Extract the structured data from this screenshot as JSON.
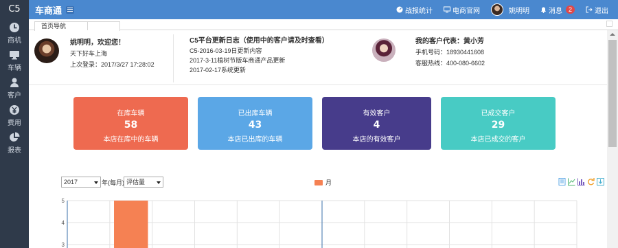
{
  "app": {
    "logo": "C5",
    "title": "车商通"
  },
  "sidebar": {
    "items": [
      {
        "label": "商机",
        "icon": "clock-icon"
      },
      {
        "label": "车辆",
        "icon": "monitor-icon"
      },
      {
        "label": "客户",
        "icon": "user-icon"
      },
      {
        "label": "费用",
        "icon": "yen-icon"
      },
      {
        "label": "报表",
        "icon": "pie-chart-icon"
      }
    ]
  },
  "topbar": {
    "stats": "战报统计",
    "site": "电商官网",
    "user": "姚明明",
    "messages": "消息",
    "message_count": "2",
    "logout": "退出"
  },
  "tabs": [
    {
      "label": "首页导航"
    }
  ],
  "info": {
    "welcome": "姚明明，欢迎您！",
    "slogan": "天下好车上海",
    "last_login": "上次登录：2017/3/27 17:28:02",
    "log_title": "C5平台更新日志（使用中的客户请及时查看）",
    "log_entries": [
      "C5-2016-03-19日更新内容",
      "2017-3-11植树节版车商通产品更新",
      "2017-02-17系统更新"
    ],
    "rep_title": "我的客户代表：黄小芳",
    "rep_phone": "手机号码：18930441608",
    "rep_hotline": "客服热线：400-080-6602"
  },
  "cards": [
    {
      "title": "在库车辆",
      "value": "58",
      "desc": "本店在库中的车辆",
      "color": "#ee6a50"
    },
    {
      "title": "已出库车辆",
      "value": "43",
      "desc": "本店已出库的车辆",
      "color": "#5ba7e6"
    },
    {
      "title": "有效客户",
      "value": "4",
      "desc": "本店的有效客户",
      "color": "#473c8b"
    },
    {
      "title": "已成交客户",
      "value": "29",
      "desc": "本店已成交的客户",
      "color": "#48cbc4"
    }
  ],
  "chart_controls": {
    "year": "2017",
    "period_label": "年(每月)",
    "metric": "评估量",
    "tools": [
      "data-view-icon",
      "line-chart-icon",
      "bar-chart-icon",
      "refresh-icon",
      "save-icon"
    ]
  },
  "chart_data": {
    "type": "bar",
    "series": [
      {
        "name": "月",
        "color": "#f58153",
        "values": [
          null,
          5
        ]
      }
    ],
    "y_ticks": [
      "5",
      "4",
      "3"
    ],
    "grid": true
  }
}
